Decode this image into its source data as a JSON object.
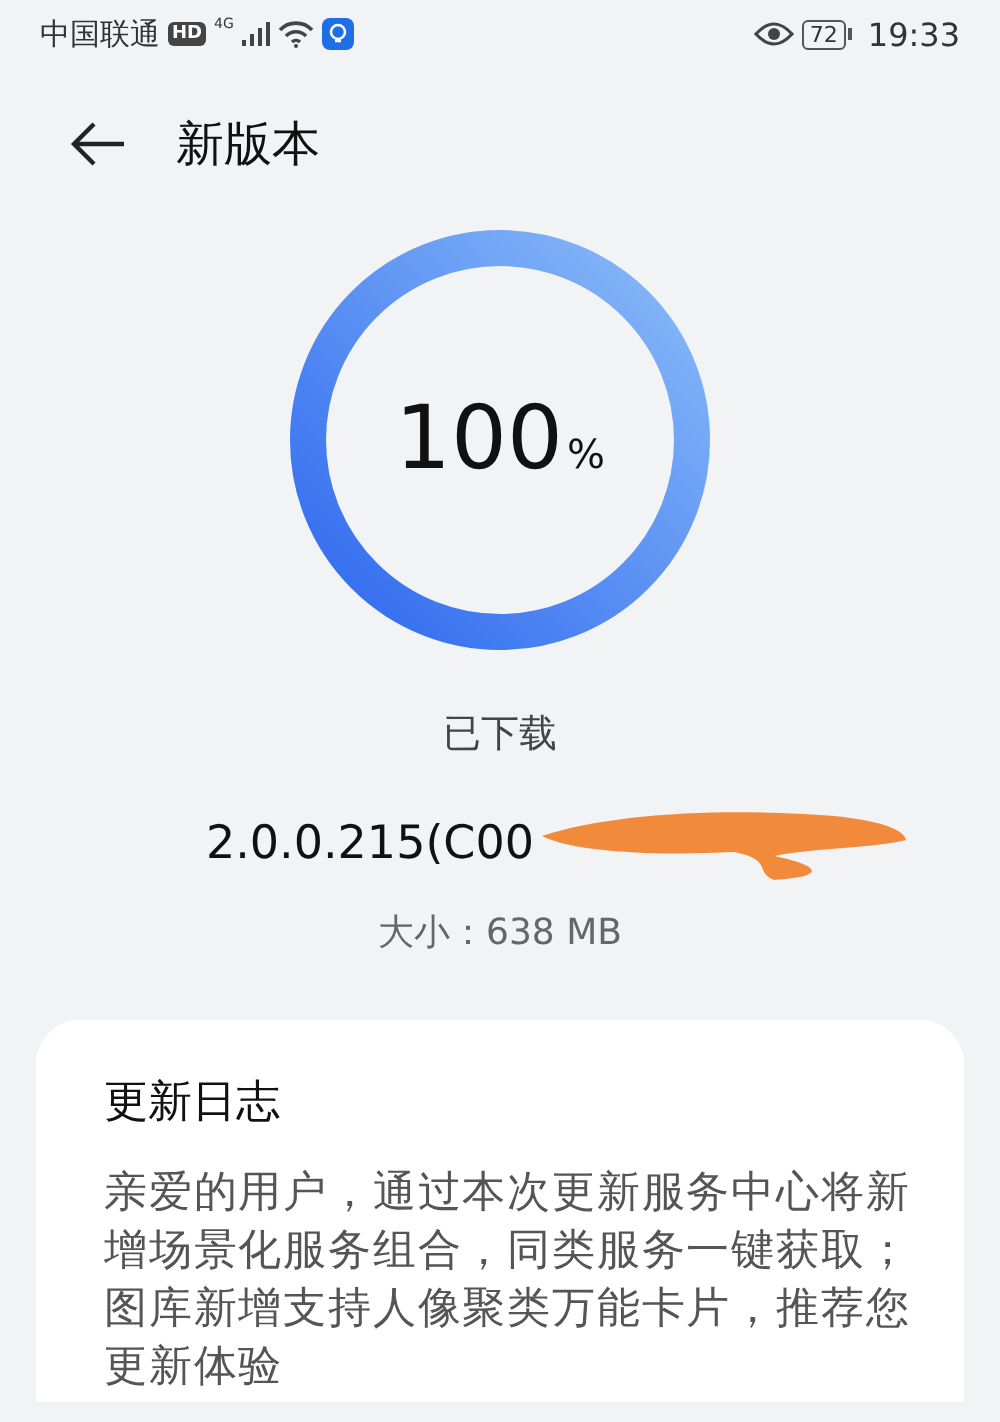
{
  "status_bar": {
    "carrier": "中国联通",
    "hd": "HD",
    "network": "4G",
    "battery": "72",
    "time": "19:33"
  },
  "header": {
    "title": "新版本"
  },
  "progress": {
    "level": 1,
    "percent": "100",
    "unit": "%"
  },
  "download_status": "已下载",
  "version": "2.0.0.215(C00",
  "size": {
    "label": "大小：",
    "value": "638 MB"
  },
  "changelog": {
    "title": "更新日志",
    "text": "亲爱的用户，通过本次更新服务中心将新增场景化服务组合，同类服务一键获取；图库新增支持人像聚类万能卡片，推荐您更新体验"
  }
}
